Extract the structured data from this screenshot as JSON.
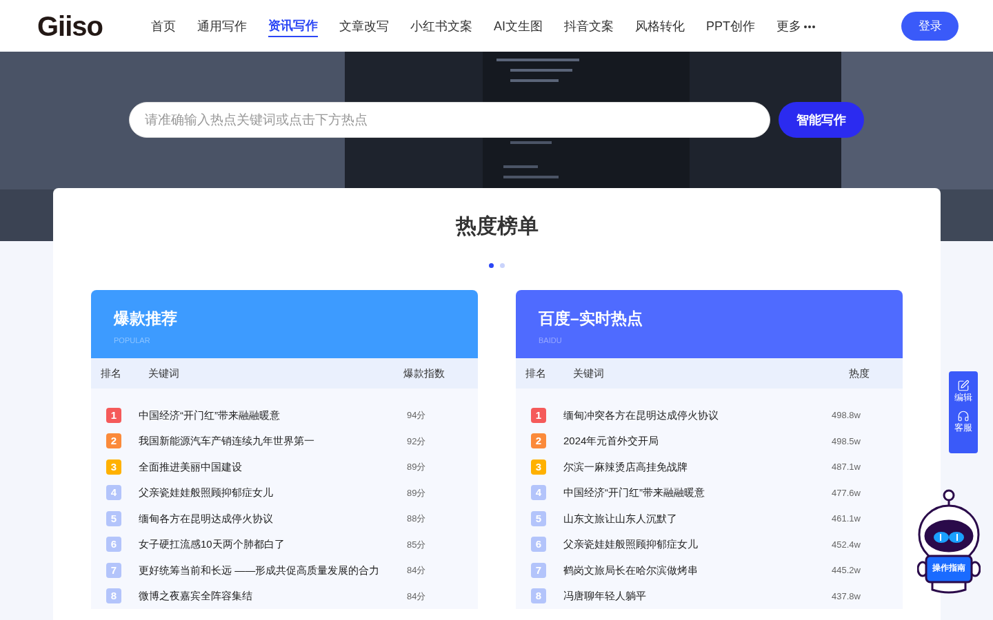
{
  "logo": "Giiso",
  "nav": [
    {
      "label": "首页",
      "selected": false
    },
    {
      "label": "通用写作",
      "selected": false
    },
    {
      "label": "资讯写作",
      "selected": true
    },
    {
      "label": "文章改写",
      "selected": false
    },
    {
      "label": "小红书文案",
      "selected": false
    },
    {
      "label": "AI文生图",
      "selected": false
    },
    {
      "label": "抖音文案",
      "selected": false
    },
    {
      "label": "风格转化",
      "selected": false
    },
    {
      "label": "PPT创作",
      "selected": false
    },
    {
      "label": "更多",
      "selected": false
    }
  ],
  "login": "登录",
  "search": {
    "placeholder": "请准确输入热点关键词或点击下方热点",
    "button": "智能写作"
  },
  "title": "热度榜单",
  "dots": [
    {
      "selected": true
    },
    {
      "selected": false
    }
  ],
  "panels": [
    {
      "title": "爆款推荐",
      "subtitle": "POPULAR",
      "color": "#3d9bff",
      "columns": [
        "排名",
        "关键词",
        "爆款指数"
      ],
      "rows": [
        {
          "rank": "1",
          "color": "#f55a5a",
          "keyword": "中国经济“开门红”带来融融暖意",
          "value": "94分"
        },
        {
          "rank": "2",
          "color": "#fb8a3a",
          "keyword": "我国新能源汽车产销连续九年世界第一",
          "value": "92分"
        },
        {
          "rank": "3",
          "color": "#ffb100",
          "keyword": "全面推进美丽中国建设",
          "value": "89分"
        },
        {
          "rank": "4",
          "color": "#b3c4fb",
          "keyword": "父亲瓷娃娃般照顾抑郁症女儿",
          "value": "89分"
        },
        {
          "rank": "5",
          "color": "#b3c4fb",
          "keyword": "缅甸各方在昆明达成停火协议",
          "value": "88分"
        },
        {
          "rank": "6",
          "color": "#b3c4fb",
          "keyword": "女子硬扛流感10天两个肺都白了",
          "value": "85分"
        },
        {
          "rank": "7",
          "color": "#b3c4fb",
          "keyword": "更好统筹当前和长远 ——形成共促高质量发展的合力",
          "value": "84分"
        },
        {
          "rank": "8",
          "color": "#b3c4fb",
          "keyword": "微博之夜嘉宾全阵容集结",
          "value": "84分"
        }
      ]
    },
    {
      "title": "百度–实时热点",
      "subtitle": "BAIDU",
      "color": "#4f6bff",
      "columns": [
        "排名",
        "关键词",
        "热度"
      ],
      "rows": [
        {
          "rank": "1",
          "color": "#f55a5a",
          "keyword": "缅甸冲突各方在昆明达成停火协议",
          "value": "498.8w"
        },
        {
          "rank": "2",
          "color": "#fb8a3a",
          "keyword": "2024年元首外交开局",
          "value": "498.5w"
        },
        {
          "rank": "3",
          "color": "#ffb100",
          "keyword": "尔滨一麻辣烫店高挂免战牌",
          "value": "487.1w"
        },
        {
          "rank": "4",
          "color": "#b3c4fb",
          "keyword": "中国经济“开门红”带来融融暖意",
          "value": "477.6w"
        },
        {
          "rank": "5",
          "color": "#b3c4fb",
          "keyword": "山东文旅让山东人沉默了",
          "value": "461.1w"
        },
        {
          "rank": "6",
          "color": "#b3c4fb",
          "keyword": "父亲瓷娃娃般照顾抑郁症女儿",
          "value": "452.4w"
        },
        {
          "rank": "7",
          "color": "#b3c4fb",
          "keyword": "鹤岗文旅局长在哈尔滨做烤串",
          "value": "445.2w"
        },
        {
          "rank": "8",
          "color": "#b3c4fb",
          "keyword": "冯唐聊年轻人躺平",
          "value": "437.8w"
        }
      ]
    }
  ],
  "side_tools": [
    {
      "kind": "edit",
      "label": "编辑"
    },
    {
      "kind": "service",
      "label": "客服"
    }
  ],
  "guide": "操作指南"
}
